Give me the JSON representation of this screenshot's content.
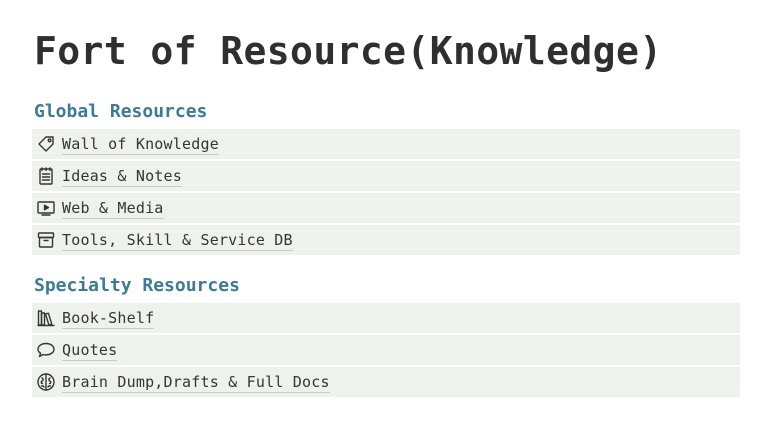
{
  "page": {
    "title": "Fort of Resource(Knowledge)"
  },
  "sections": [
    {
      "heading": "Global Resources",
      "items": [
        {
          "label": "Wall of Knowledge",
          "icon": "tag-icon"
        },
        {
          "label": "Ideas & Notes",
          "icon": "notepad-icon"
        },
        {
          "label": "Web & Media",
          "icon": "video-player-icon"
        },
        {
          "label": "Tools, Skill & Service DB",
          "icon": "archive-box-icon"
        }
      ]
    },
    {
      "heading": "Specialty Resources",
      "items": [
        {
          "label": "Book-Shelf",
          "icon": "books-icon"
        },
        {
          "label": "Quotes",
          "icon": "speech-bubble-icon"
        },
        {
          "label": "Brain Dump,Drafts & Full Docs",
          "icon": "brain-icon"
        }
      ]
    }
  ],
  "colors": {
    "heading": "#3b7a99",
    "row_background": "#eef2ec",
    "text": "#37352f"
  }
}
